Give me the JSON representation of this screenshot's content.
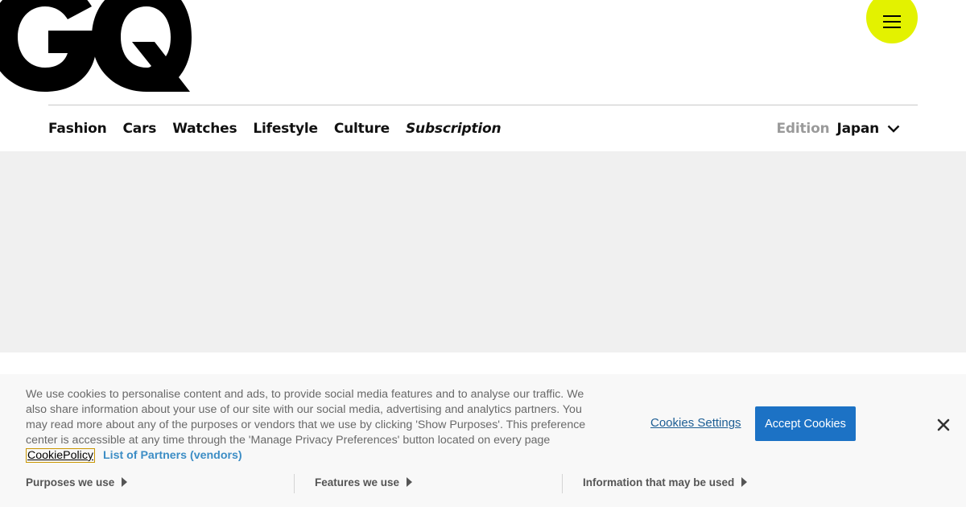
{
  "logo": {
    "text": "GQ"
  },
  "header": {
    "menu_icon": "hamburger-menu-icon",
    "nav": [
      {
        "label": "Fashion",
        "italic": false
      },
      {
        "label": "Cars",
        "italic": false
      },
      {
        "label": "Watches",
        "italic": false
      },
      {
        "label": "Lifestyle",
        "italic": false
      },
      {
        "label": "Culture",
        "italic": false
      },
      {
        "label": "Subscription",
        "italic": true
      }
    ],
    "edition_label": "Edition",
    "edition_value": "Japan",
    "edition_icon": "chevron-down-icon",
    "accent_color": "#e3f200"
  },
  "cookie_banner": {
    "text": "We use cookies to personalise content and ads, to provide social media features and to analyse our traffic. We also share information about your use of our site with our social media, advertising and analytics partners. You may read more about any of the purposes or vendors that we use by clicking 'Show Purposes'. This preference center is accessible at any time through the 'Manage Privacy Preferences' button located on every page",
    "cookie_policy_link": "CookiePolicy",
    "partners_link": "List of Partners (vendors)",
    "settings_link": "Cookies Settings",
    "accept_button": "Accept Cookies",
    "accept_color": "#1c72c5",
    "close_icon": "close-icon",
    "sections": [
      {
        "label": "Purposes we use"
      },
      {
        "label": "Features we use"
      },
      {
        "label": "Information that may be used"
      }
    ]
  }
}
